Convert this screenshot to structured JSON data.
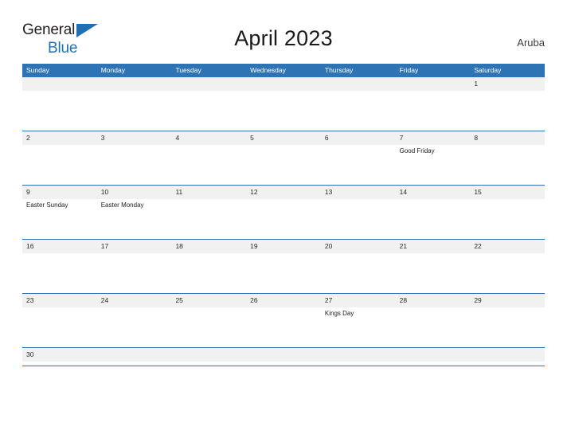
{
  "brand": {
    "name_part1": "General",
    "name_part2": "Blue",
    "triangle_icon": "triangle-logo-icon",
    "color_dark": "#231f20",
    "color_blue": "#1F6FB2"
  },
  "header": {
    "title": "April 2023",
    "country": "Aruba"
  },
  "calendar": {
    "accent_color": "#2E74B5",
    "band_color": "#F1F1F1",
    "weekdays": [
      "Sunday",
      "Monday",
      "Tuesday",
      "Wednesday",
      "Thursday",
      "Friday",
      "Saturday"
    ],
    "weeks": [
      {
        "days": [
          {
            "number": "",
            "events": []
          },
          {
            "number": "",
            "events": []
          },
          {
            "number": "",
            "events": []
          },
          {
            "number": "",
            "events": []
          },
          {
            "number": "",
            "events": []
          },
          {
            "number": "",
            "events": []
          },
          {
            "number": "1",
            "events": []
          }
        ]
      },
      {
        "days": [
          {
            "number": "2",
            "events": []
          },
          {
            "number": "3",
            "events": []
          },
          {
            "number": "4",
            "events": []
          },
          {
            "number": "5",
            "events": []
          },
          {
            "number": "6",
            "events": []
          },
          {
            "number": "7",
            "events": [
              "Good Friday"
            ]
          },
          {
            "number": "8",
            "events": []
          }
        ]
      },
      {
        "days": [
          {
            "number": "9",
            "events": [
              "Easter Sunday"
            ]
          },
          {
            "number": "10",
            "events": [
              "Easter Monday"
            ]
          },
          {
            "number": "11",
            "events": []
          },
          {
            "number": "12",
            "events": []
          },
          {
            "number": "13",
            "events": []
          },
          {
            "number": "14",
            "events": []
          },
          {
            "number": "15",
            "events": []
          }
        ]
      },
      {
        "days": [
          {
            "number": "16",
            "events": []
          },
          {
            "number": "17",
            "events": []
          },
          {
            "number": "18",
            "events": []
          },
          {
            "number": "19",
            "events": []
          },
          {
            "number": "20",
            "events": []
          },
          {
            "number": "21",
            "events": []
          },
          {
            "number": "22",
            "events": []
          }
        ]
      },
      {
        "days": [
          {
            "number": "23",
            "events": []
          },
          {
            "number": "24",
            "events": []
          },
          {
            "number": "25",
            "events": []
          },
          {
            "number": "26",
            "events": []
          },
          {
            "number": "27",
            "events": [
              "Kings Day"
            ]
          },
          {
            "number": "28",
            "events": []
          },
          {
            "number": "29",
            "events": []
          }
        ]
      },
      {
        "short": true,
        "days": [
          {
            "number": "30",
            "events": []
          },
          {
            "number": "",
            "events": []
          },
          {
            "number": "",
            "events": []
          },
          {
            "number": "",
            "events": []
          },
          {
            "number": "",
            "events": []
          },
          {
            "number": "",
            "events": []
          },
          {
            "number": "",
            "events": []
          }
        ]
      }
    ]
  }
}
